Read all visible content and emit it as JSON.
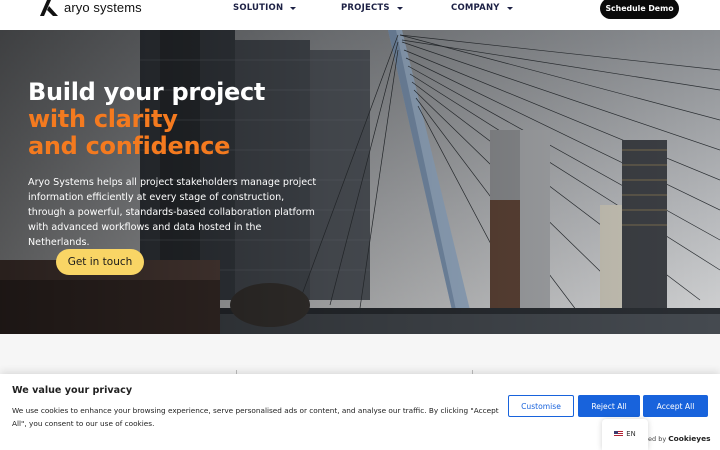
{
  "header": {
    "brand": "aryo systems",
    "nav": [
      {
        "label": "SOLUTION"
      },
      {
        "label": "PROJECTS"
      },
      {
        "label": "COMPANY"
      }
    ],
    "cta_label": "Schedule Demo"
  },
  "hero": {
    "title_line1": "Build your project",
    "title_line2": "with clarity",
    "title_line3": "and confidence",
    "description": "Aryo Systems helps all project stakeholders manage project information efficiently at every stage of construction, through a powerful, standards-based collaboration platform with advanced workflows and data hosted in the Netherlands.",
    "button_label": "Get in touch",
    "accent_color": "#f47a1f",
    "button_color": "#f9d565"
  },
  "cookie_banner": {
    "title": "We value your privacy",
    "text": "We use cookies to enhance your browsing experience, serve personalised ads or content, and analyse our traffic. By clicking \"Accept All\", you consent to our use of cookies.",
    "customise_label": "Customise",
    "reject_label": "Reject All",
    "accept_label": "Accept All",
    "powered_prefix": "ed by",
    "powered_brand": "Cookieyes",
    "brand_color": "#1863dc"
  },
  "language": {
    "code": "EN",
    "flag_icon": "us-flag-icon"
  }
}
